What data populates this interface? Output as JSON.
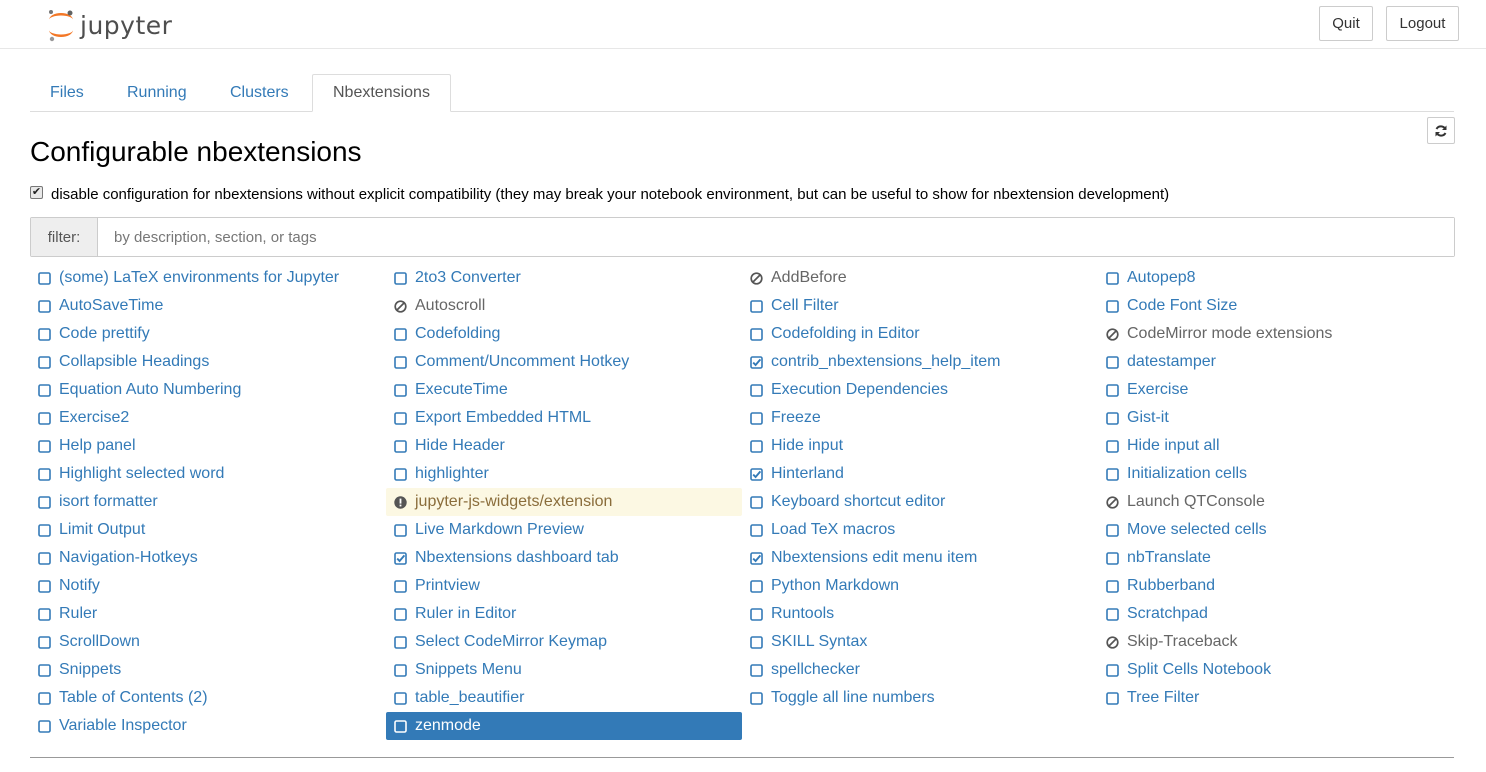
{
  "header": {
    "logo_text": "jupyter",
    "quit_label": "Quit",
    "logout_label": "Logout"
  },
  "tabs": [
    {
      "label": "Files",
      "active": false
    },
    {
      "label": "Running",
      "active": false
    },
    {
      "label": "Clusters",
      "active": false
    },
    {
      "label": "Nbextensions",
      "active": true
    }
  ],
  "page_title": "Configurable nbextensions",
  "compat": {
    "checked": true,
    "label": "disable configuration for nbextensions without explicit compatibility (they may break your notebook environment, but can be useful to show for nbextension development)"
  },
  "filter": {
    "label": "filter:",
    "placeholder": "by description, section, or tags",
    "value": ""
  },
  "colors": {
    "link": "#337ab7",
    "warning_bg": "#fcf8e3",
    "selected_bg": "#337ab7"
  },
  "extensions": [
    {
      "label": "(some) LaTeX environments for Jupyter",
      "state": "unchecked"
    },
    {
      "label": "2to3 Converter",
      "state": "unchecked"
    },
    {
      "label": "AddBefore",
      "state": "incompatible"
    },
    {
      "label": "Autopep8",
      "state": "unchecked"
    },
    {
      "label": "AutoSaveTime",
      "state": "unchecked"
    },
    {
      "label": "Autoscroll",
      "state": "incompatible"
    },
    {
      "label": "Cell Filter",
      "state": "unchecked"
    },
    {
      "label": "Code Font Size",
      "state": "unchecked"
    },
    {
      "label": "Code prettify",
      "state": "unchecked"
    },
    {
      "label": "Codefolding",
      "state": "unchecked"
    },
    {
      "label": "Codefolding in Editor",
      "state": "unchecked"
    },
    {
      "label": "CodeMirror mode extensions",
      "state": "incompatible"
    },
    {
      "label": "Collapsible Headings",
      "state": "unchecked"
    },
    {
      "label": "Comment/Uncomment Hotkey",
      "state": "unchecked"
    },
    {
      "label": "contrib_nbextensions_help_item",
      "state": "checked"
    },
    {
      "label": "datestamper",
      "state": "unchecked"
    },
    {
      "label": "Equation Auto Numbering",
      "state": "unchecked"
    },
    {
      "label": "ExecuteTime",
      "state": "unchecked"
    },
    {
      "label": "Execution Dependencies",
      "state": "unchecked"
    },
    {
      "label": "Exercise",
      "state": "unchecked"
    },
    {
      "label": "Exercise2",
      "state": "unchecked"
    },
    {
      "label": "Export Embedded HTML",
      "state": "unchecked"
    },
    {
      "label": "Freeze",
      "state": "unchecked"
    },
    {
      "label": "Gist-it",
      "state": "unchecked"
    },
    {
      "label": "Help panel",
      "state": "unchecked"
    },
    {
      "label": "Hide Header",
      "state": "unchecked"
    },
    {
      "label": "Hide input",
      "state": "unchecked"
    },
    {
      "label": "Hide input all",
      "state": "unchecked"
    },
    {
      "label": "Highlight selected word",
      "state": "unchecked"
    },
    {
      "label": "highlighter",
      "state": "unchecked"
    },
    {
      "label": "Hinterland",
      "state": "checked"
    },
    {
      "label": "Initialization cells",
      "state": "unchecked"
    },
    {
      "label": "isort formatter",
      "state": "unchecked"
    },
    {
      "label": "jupyter-js-widgets/extension",
      "state": "warning"
    },
    {
      "label": "Keyboard shortcut editor",
      "state": "unchecked"
    },
    {
      "label": "Launch QTConsole",
      "state": "incompatible"
    },
    {
      "label": "Limit Output",
      "state": "unchecked"
    },
    {
      "label": "Live Markdown Preview",
      "state": "unchecked"
    },
    {
      "label": "Load TeX macros",
      "state": "unchecked"
    },
    {
      "label": "Move selected cells",
      "state": "unchecked"
    },
    {
      "label": "Navigation-Hotkeys",
      "state": "unchecked"
    },
    {
      "label": "Nbextensions dashboard tab",
      "state": "checked"
    },
    {
      "label": "Nbextensions edit menu item",
      "state": "checked"
    },
    {
      "label": "nbTranslate",
      "state": "unchecked"
    },
    {
      "label": "Notify",
      "state": "unchecked"
    },
    {
      "label": "Printview",
      "state": "unchecked"
    },
    {
      "label": "Python Markdown",
      "state": "unchecked"
    },
    {
      "label": "Rubberband",
      "state": "unchecked"
    },
    {
      "label": "Ruler",
      "state": "unchecked"
    },
    {
      "label": "Ruler in Editor",
      "state": "unchecked"
    },
    {
      "label": "Runtools",
      "state": "unchecked"
    },
    {
      "label": "Scratchpad",
      "state": "unchecked"
    },
    {
      "label": "ScrollDown",
      "state": "unchecked"
    },
    {
      "label": "Select CodeMirror Keymap",
      "state": "unchecked"
    },
    {
      "label": "SKILL Syntax",
      "state": "unchecked"
    },
    {
      "label": "Skip-Traceback",
      "state": "incompatible"
    },
    {
      "label": "Snippets",
      "state": "unchecked"
    },
    {
      "label": "Snippets Menu",
      "state": "unchecked"
    },
    {
      "label": "spellchecker",
      "state": "unchecked"
    },
    {
      "label": "Split Cells Notebook",
      "state": "unchecked"
    },
    {
      "label": "Table of Contents (2)",
      "state": "unchecked"
    },
    {
      "label": "table_beautifier",
      "state": "unchecked"
    },
    {
      "label": "Toggle all line numbers",
      "state": "unchecked"
    },
    {
      "label": "Tree Filter",
      "state": "unchecked"
    },
    {
      "label": "Variable Inspector",
      "state": "unchecked"
    },
    {
      "label": "zenmode",
      "state": "selected"
    }
  ]
}
